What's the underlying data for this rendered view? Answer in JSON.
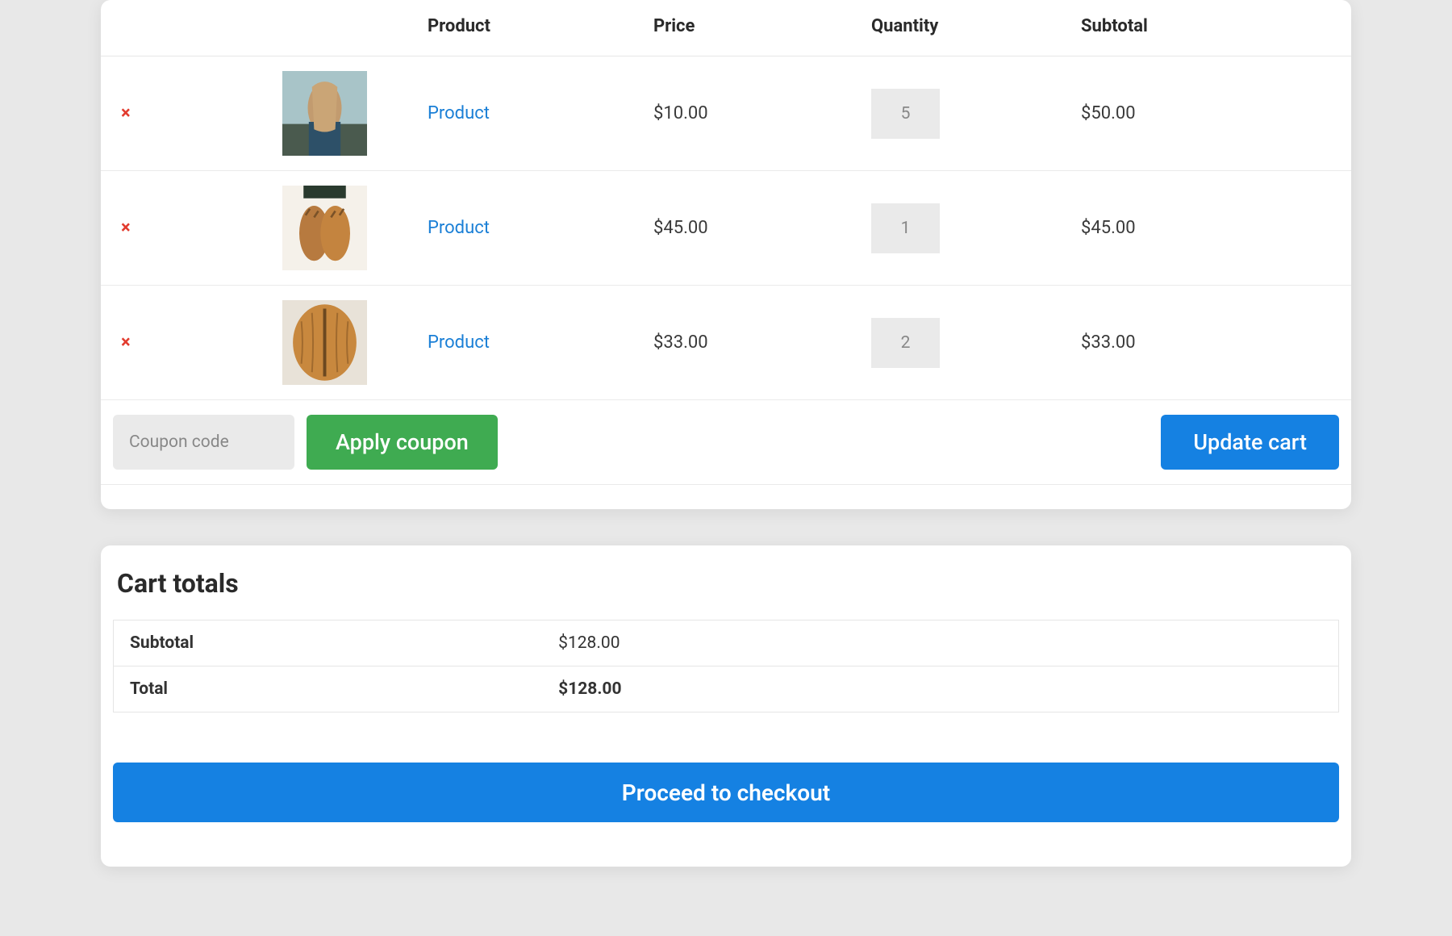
{
  "table": {
    "headers": {
      "product": "Product",
      "price": "Price",
      "quantity": "Quantity",
      "subtotal": "Subtotal"
    },
    "items": [
      {
        "product_label": "Product",
        "price": "$10.00",
        "quantity": "5",
        "subtotal": "$50.00"
      },
      {
        "product_label": "Product",
        "price": "$45.00",
        "quantity": "1",
        "subtotal": "$45.00"
      },
      {
        "product_label": "Product",
        "price": "$33.00",
        "quantity": "2",
        "subtotal": "$33.00"
      }
    ]
  },
  "coupon": {
    "placeholder": "Coupon code",
    "apply_label": "Apply coupon"
  },
  "update_label": "Update cart",
  "totals": {
    "title": "Cart totals",
    "subtotal_label": "Subtotal",
    "subtotal_value": "$128.00",
    "total_label": "Total",
    "total_value": "$128.00"
  },
  "checkout_label": "Proceed to checkout",
  "remove_glyph": "×"
}
